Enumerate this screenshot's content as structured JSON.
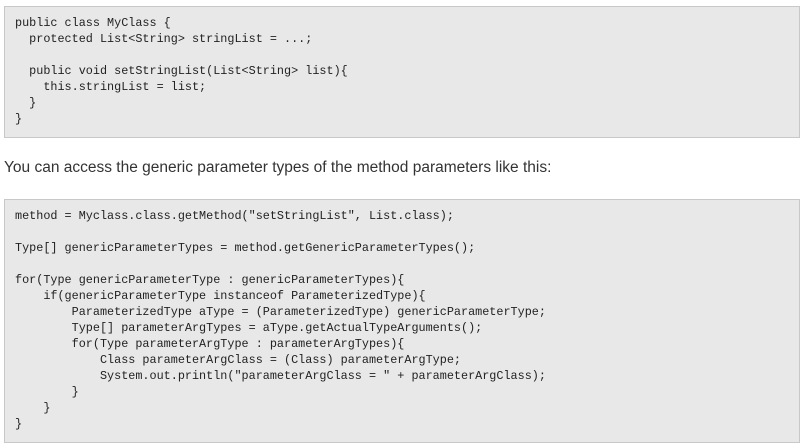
{
  "code_block_1": {
    "lines": [
      "public class MyClass {",
      "  protected List<String> stringList = ...;",
      "",
      "  public void setStringList(List<String> list){",
      "    this.stringList = list;",
      "  }",
      "}"
    ]
  },
  "paragraph": {
    "text": "You can access the generic parameter types of the method parameters like this:"
  },
  "code_block_2": {
    "lines": [
      "method = Myclass.class.getMethod(\"setStringList\", List.class);",
      "",
      "Type[] genericParameterTypes = method.getGenericParameterTypes();",
      "",
      "for(Type genericParameterType : genericParameterTypes){",
      "    if(genericParameterType instanceof ParameterizedType){",
      "        ParameterizedType aType = (ParameterizedType) genericParameterType;",
      "        Type[] parameterArgTypes = aType.getActualTypeArguments();",
      "        for(Type parameterArgType : parameterArgTypes){",
      "            Class parameterArgClass = (Class) parameterArgType;",
      "            System.out.println(\"parameterArgClass = \" + parameterArgClass);",
      "        }",
      "    }",
      "}"
    ]
  }
}
